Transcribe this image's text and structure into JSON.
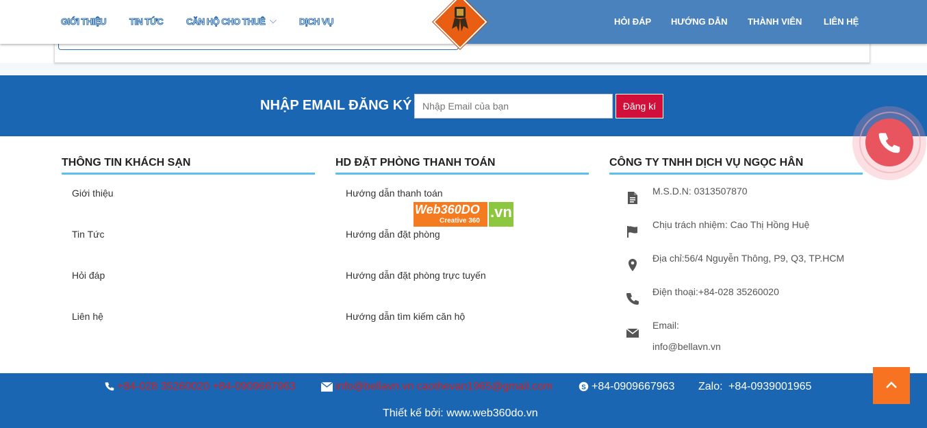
{
  "header": {
    "nav_left": [
      "GIỚI THIỆU",
      "TIN TỨC",
      "CĂN HỘ CHO THUÊ",
      "DỊCH VỤ"
    ],
    "nav_right": [
      "HỎI ĐÁP",
      "HƯỚNG DẪN",
      "THÀNH VIÊN",
      "LIÊN HỆ"
    ],
    "logo_icon": "award-badge-icon",
    "dropdown_icon": "chevron-down-icon"
  },
  "newsletter": {
    "title": "NHẬP EMAIL ĐĂNG KÝ",
    "placeholder": "Nhập Email của bạn",
    "button": "Đăng kí"
  },
  "columns": [
    {
      "title": "THÔNG TIN KHÁCH SẠN",
      "links": [
        "Giới thiệu",
        "Tin Tức",
        "Hỏi đáp",
        "Liên hệ"
      ]
    },
    {
      "title": "HD ĐẶT PHÒNG THANH TOÁN",
      "links": [
        "Hướng dẫn thanh toán",
        "Hướng dẫn đặt phòng",
        "Hướng dẫn đặt phòng trực tuyến",
        "Hướng dẫn tìm kiếm căn hộ"
      ]
    },
    {
      "title": "CÔNG TY TNHH DỊCH VỤ NGỌC HÂN",
      "info": [
        {
          "icon": "document-icon",
          "text": "M.S.D.N: 0313507870"
        },
        {
          "icon": "flag-icon",
          "text": "Chịu trách nhiệm: Cao Thị Hồng Huệ"
        },
        {
          "icon": "map-marker-icon",
          "text": "Địa chỉ:56/4 Nguyễn Thông, P9, Q3, TP.HCM"
        },
        {
          "icon": "phone-icon",
          "text": "Điện thoại:+84-028 35260020"
        },
        {
          "icon": "envelope-icon",
          "text": "Email:",
          "text2": "info@bellavn.vn"
        }
      ]
    }
  ],
  "watermark": {
    "brand": "Web360DO",
    "tld": ".vn",
    "tagline": "Creative 360"
  },
  "bottom": {
    "phones": "+84-028 35260020  +84-0909667963",
    "emails": "info@bellavn.vn  caothevan1965@gmail.com",
    "skype": "+84-0909667963",
    "zalo_label": "Zalo:",
    "zalo": "+84-0939001965",
    "credit": "Thiết kế bởi:  www.web360do.vn"
  },
  "colors": {
    "primary_blue": "#1a66b2",
    "header_blue": "#4a82bd",
    "accent_line": "#5bc0eb",
    "button_red": "#d0103a",
    "orange": "#f77221",
    "phone_pink": "#e8555f"
  }
}
